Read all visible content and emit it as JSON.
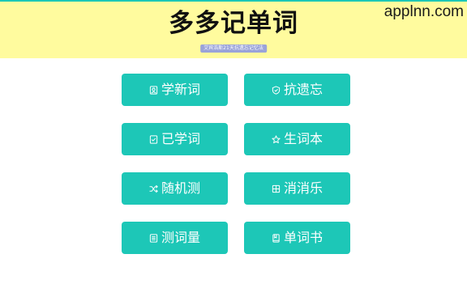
{
  "header": {
    "title": "多多记单词",
    "subtitle": "艾宾浩斯21天抗遗忘记忆法",
    "watermark": "applnn.com"
  },
  "colors": {
    "header_bg": "#fffb9e",
    "accent": "#1dc7b7",
    "badge_bg": "#9aa3d9"
  },
  "menu": {
    "items": [
      {
        "label": "学新词",
        "icon": "portrait-icon"
      },
      {
        "label": "抗遗忘",
        "icon": "shield-icon"
      },
      {
        "label": "已学词",
        "icon": "checklist-icon"
      },
      {
        "label": "生词本",
        "icon": "star-icon"
      },
      {
        "label": "随机测",
        "icon": "shuffle-icon"
      },
      {
        "label": "消消乐",
        "icon": "grid-icon"
      },
      {
        "label": "测词量",
        "icon": "list-icon"
      },
      {
        "label": "单词书",
        "icon": "book-icon"
      }
    ]
  }
}
